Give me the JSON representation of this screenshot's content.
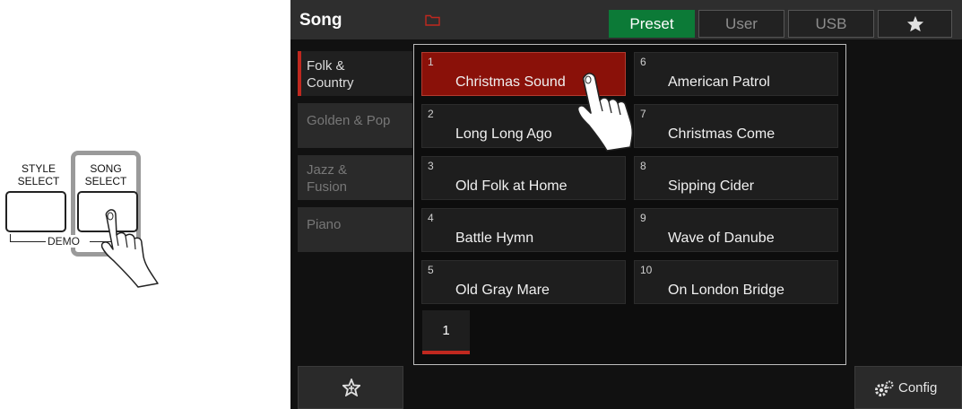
{
  "panel": {
    "style_select_label_1": "STYLE",
    "style_select_label_2": "SELECT",
    "song_select_label_1": "SONG",
    "song_select_label_2": "SELECT",
    "demo_label": "DEMO"
  },
  "screen": {
    "title": "Song",
    "tabs": [
      {
        "label": "Preset",
        "active": true
      },
      {
        "label": "User",
        "active": false
      },
      {
        "label": "USB",
        "active": false
      }
    ],
    "categories": [
      {
        "line1": "Folk &",
        "line2": "Country",
        "active": true
      },
      {
        "line1": "Golden & Pop",
        "line2": "",
        "active": false
      },
      {
        "line1": "Jazz &",
        "line2": "Fusion",
        "active": false
      },
      {
        "line1": "Piano",
        "line2": "",
        "active": false
      }
    ],
    "songs": [
      {
        "number": "1",
        "name": "Christmas Sound",
        "selected": true
      },
      {
        "number": "2",
        "name": "Long Long Ago",
        "selected": false
      },
      {
        "number": "3",
        "name": "Old Folk at Home",
        "selected": false
      },
      {
        "number": "4",
        "name": "Battle Hymn",
        "selected": false
      },
      {
        "number": "5",
        "name": "Old Gray Mare",
        "selected": false
      },
      {
        "number": "6",
        "name": "American Patrol",
        "selected": false
      },
      {
        "number": "7",
        "name": "Christmas Come",
        "selected": false
      },
      {
        "number": "8",
        "name": "Sipping Cider",
        "selected": false
      },
      {
        "number": "9",
        "name": "Wave of Danube",
        "selected": false
      },
      {
        "number": "10",
        "name": "On London Bridge",
        "selected": false
      }
    ],
    "page": "1",
    "config_label": "Config"
  },
  "colors": {
    "accent_green": "#0c7a37",
    "selected_red": "#8a1109",
    "indicator_red": "#c0281f"
  },
  "icons": [
    "folder-icon",
    "star-icon",
    "favorite-add-icon",
    "gear-icon",
    "pointing-hand-icon"
  ]
}
